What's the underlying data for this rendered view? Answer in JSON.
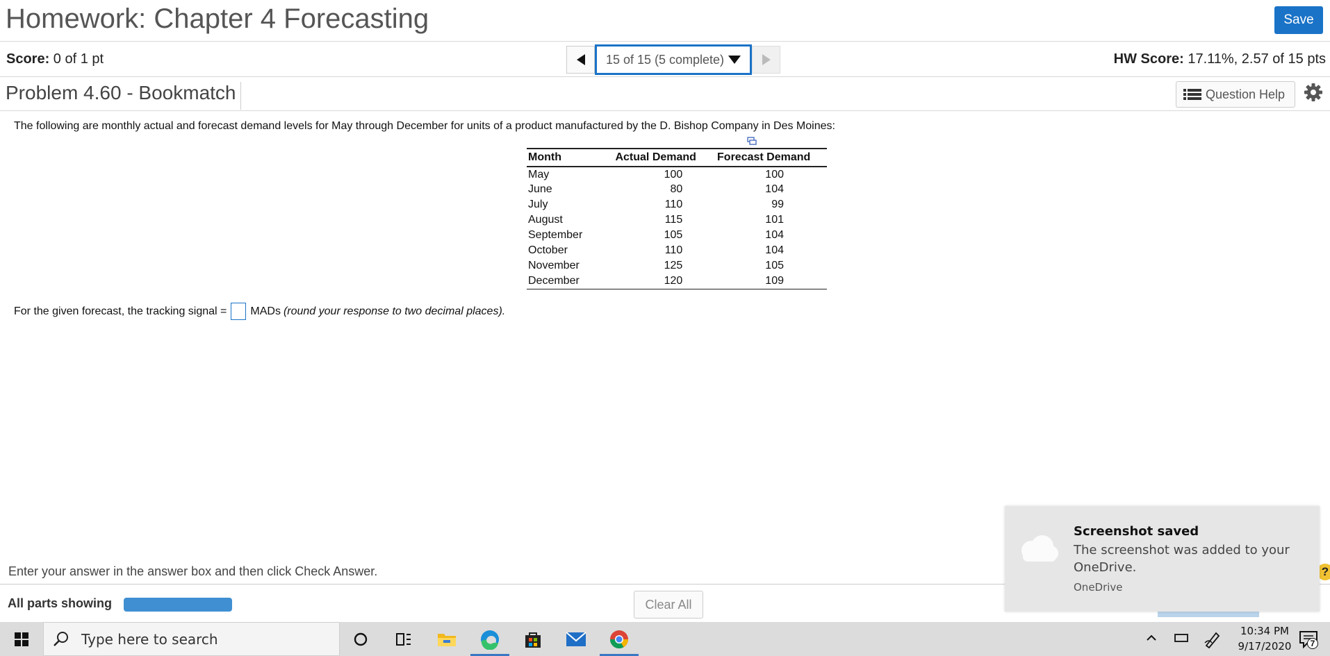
{
  "header": {
    "title": "Homework: Chapter 4 Forecasting",
    "save_label": "Save"
  },
  "scorebar": {
    "score_label": "Score:",
    "score_value": " 0 of 1 pt",
    "nav_selected": "15 of 15 (5 complete)",
    "hw_score_label": "HW Score:",
    "hw_score_value": " 17.11%, 2.57 of 15 pts"
  },
  "problem": {
    "title": "Problem 4.60 - Bookmatch",
    "help_label": "Question Help",
    "intro": "The following are monthly actual and forecast demand levels for May through December for units of a product manufactured by the D. Bishop Company in Des Moines:",
    "table": {
      "headers": [
        "Month",
        "Actual Demand",
        "Forecast Demand"
      ],
      "rows": [
        [
          "May",
          "100",
          "100"
        ],
        [
          "June",
          "80",
          "104"
        ],
        [
          "July",
          "110",
          "99"
        ],
        [
          "August",
          "115",
          "101"
        ],
        [
          "September",
          "105",
          "104"
        ],
        [
          "October",
          "110",
          "104"
        ],
        [
          "November",
          "125",
          "105"
        ],
        [
          "December",
          "120",
          "109"
        ]
      ]
    },
    "question_prefix": "For the given forecast, the tracking signal =",
    "answer_value": "",
    "question_unit": "MADs",
    "question_note": "(round your response to two decimal places).",
    "instruction": "Enter your answer in the answer box and then click Check Answer."
  },
  "bottombar": {
    "all_parts": "All parts showing",
    "clear_all": "Clear All",
    "progress_fraction": 1.0
  },
  "toast": {
    "title": "Screenshot saved",
    "body": "The screenshot was added to your OneDrive.",
    "source": "OneDrive"
  },
  "taskbar": {
    "search_placeholder": "Type here to search",
    "time": "10:34 PM",
    "date": "9/17/2020",
    "notification_count": "7",
    "apps": [
      "cortana-icon",
      "task-view-icon",
      "file-explorer-icon",
      "edge-icon",
      "store-icon",
      "mail-icon",
      "chrome-icon"
    ]
  },
  "colors": {
    "accent": "#1a73c7",
    "progress": "#3f8fd2",
    "taskbar": "#dcdcdc",
    "toast": "#e6e6e6"
  }
}
